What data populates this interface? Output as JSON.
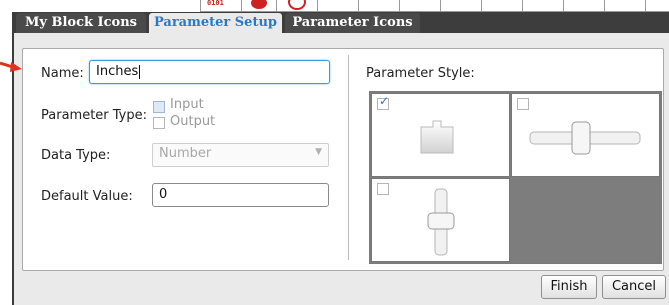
{
  "header": {
    "strip_label": "0101"
  },
  "tabs": [
    {
      "label": "My Block Icons",
      "active": false
    },
    {
      "label": "Parameter Setup",
      "active": true
    },
    {
      "label": "Parameter Icons",
      "active": false
    }
  ],
  "form": {
    "name_label": "Name:",
    "name_value": "Inches",
    "parameter_type_label": "Parameter Type:",
    "parameter_type_options": [
      {
        "label": "Input",
        "checked": true,
        "enabled": false
      },
      {
        "label": "Output",
        "checked": false,
        "enabled": false
      }
    ],
    "data_type_label": "Data Type:",
    "data_type_value": "Number",
    "default_value_label": "Default Value:",
    "default_value_value": "0"
  },
  "parameter_style": {
    "label": "Parameter Style:",
    "options": [
      {
        "icon": "text-input-icon",
        "checked": true
      },
      {
        "icon": "horizontal-slider-icon",
        "checked": false
      },
      {
        "icon": "vertical-slider-icon",
        "checked": false
      }
    ]
  },
  "buttons": {
    "finish": "Finish",
    "cancel": "Cancel"
  },
  "colors": {
    "accent": "#2a79c2",
    "frame": "#3d3d3d",
    "pointer": "#e0301e"
  }
}
